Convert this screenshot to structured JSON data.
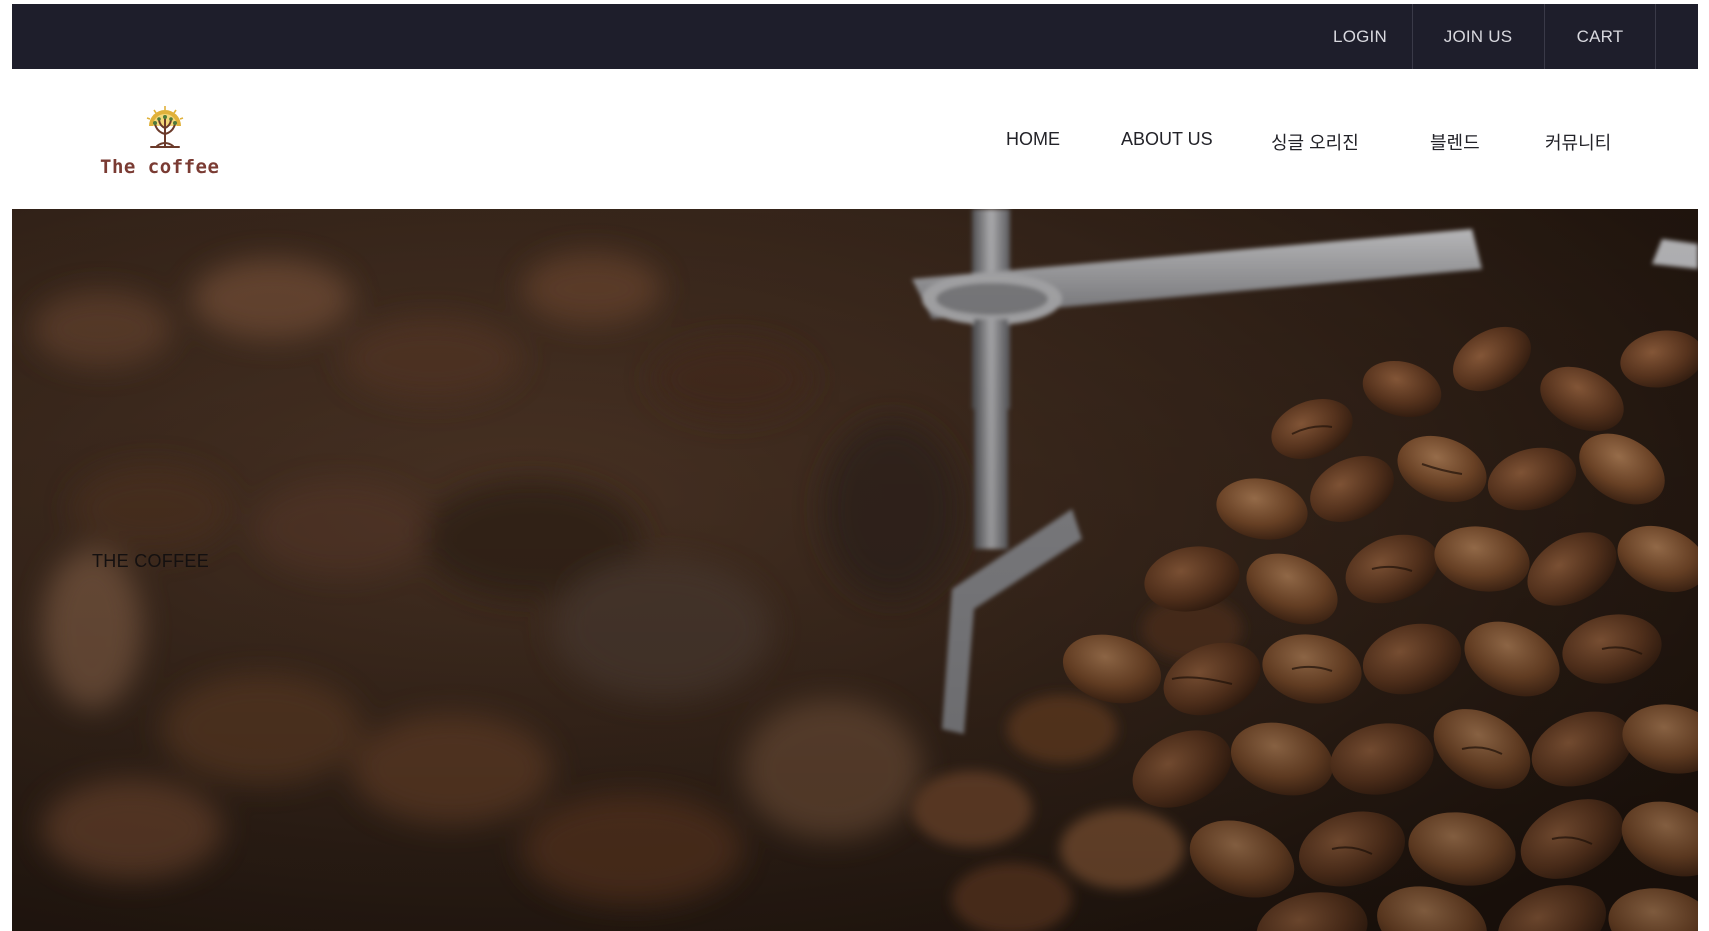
{
  "topbar": {
    "login": "LOGIN",
    "join": "JOIN US",
    "cart": "CART"
  },
  "logo": {
    "text": "The coffee",
    "icon": "coffee-tree-icon"
  },
  "nav": {
    "items": [
      {
        "label": "HOME"
      },
      {
        "label": "ABOUT US"
      },
      {
        "label": "싱글 오리진"
      },
      {
        "label": "블렌드"
      },
      {
        "label": "커뮤니티"
      }
    ]
  },
  "hero": {
    "title": "THE COFFEE"
  },
  "colors": {
    "topbar_bg": "#1e1e2b",
    "topbar_text": "#d8d8de",
    "logo_text": "#7a3b33",
    "logo_gold": "#e0b13a",
    "hero_base": "#3a2618"
  }
}
